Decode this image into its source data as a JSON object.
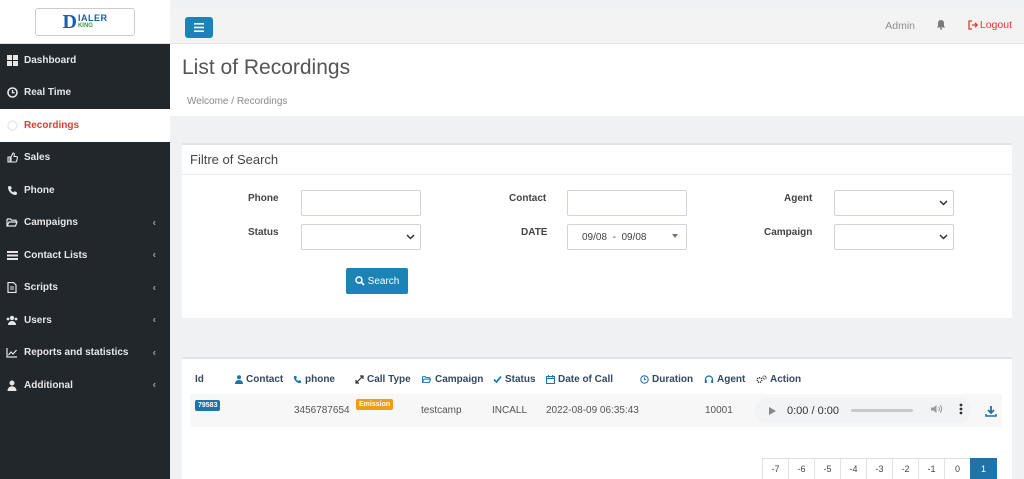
{
  "logo": {
    "mark": "D",
    "line1": "IALER",
    "line2": "KING"
  },
  "sidebar": {
    "items": [
      {
        "label": "Dashboard",
        "icon": "dashboard-icon",
        "active": false,
        "submenu": false
      },
      {
        "label": "Real Time",
        "icon": "clock-icon",
        "active": false,
        "submenu": false
      },
      {
        "label": "Recordings",
        "icon": "record-icon",
        "active": true,
        "submenu": false
      },
      {
        "label": "Sales",
        "icon": "thumbs-up-icon",
        "active": false,
        "submenu": false
      },
      {
        "label": "Phone",
        "icon": "phone-icon",
        "active": false,
        "submenu": false
      },
      {
        "label": "Campaigns",
        "icon": "folder-open-icon",
        "active": false,
        "submenu": true
      },
      {
        "label": "Contact Lists",
        "icon": "list-icon",
        "active": false,
        "submenu": true
      },
      {
        "label": "Scripts",
        "icon": "file-icon",
        "active": false,
        "submenu": true
      },
      {
        "label": "Users",
        "icon": "users-icon",
        "active": false,
        "submenu": true
      },
      {
        "label": "Reports and statistics",
        "icon": "line-chart-icon",
        "active": false,
        "submenu": true
      },
      {
        "label": "Additional",
        "icon": "user-icon",
        "active": false,
        "submenu": true
      }
    ]
  },
  "topbar": {
    "admin": "Admin",
    "logout": "Logout"
  },
  "header": {
    "title": "List of Recordings",
    "breadcrumb": "Welcome / Recordings"
  },
  "filter": {
    "title": "Filtre of Search",
    "phone_label": "Phone",
    "contact_label": "Contact",
    "agent_label": "Agent",
    "status_label": "Status",
    "date_label": "DATE",
    "date_value": "09/08  -  09/08",
    "campaign_label": "Campaign",
    "search_label": "Search"
  },
  "table": {
    "headers": {
      "id": "Id",
      "contact": "Contact",
      "phone": "phone",
      "call_type": "Call Type",
      "campaign": "Campaign",
      "status": "Status",
      "date": "Date of Call",
      "duration": "Duration",
      "agent": "Agent",
      "action": "Action"
    },
    "rows": [
      {
        "id": "79583",
        "contact": "",
        "phone": "3456787654",
        "call_type": "Emission",
        "campaign": "testcamp",
        "status": "INCALL",
        "date": "2022-08-09 06:35:43",
        "duration": "",
        "agent": "10001",
        "audio_time": "0:00 / 0:00"
      }
    ]
  },
  "pagination": [
    "-7",
    "-6",
    "-5",
    "-4",
    "-3",
    "-2",
    "-1",
    "0",
    "1"
  ],
  "pagination_active": "1",
  "colors": {
    "sidebar": "#22272c",
    "accent": "#1b83b5",
    "logout": "#e23b2e",
    "emission": "#f39c12"
  }
}
